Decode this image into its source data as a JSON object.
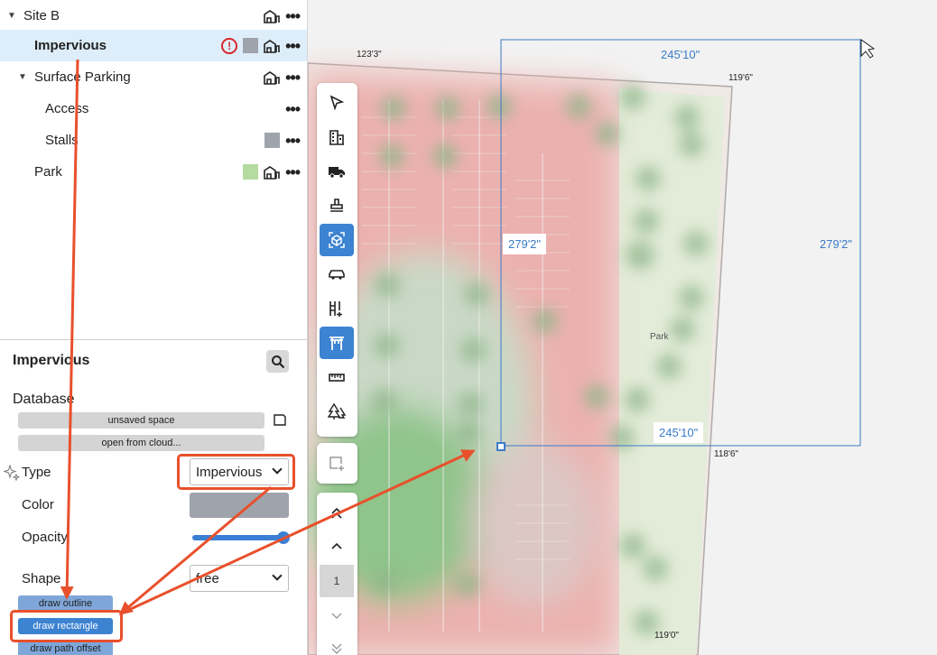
{
  "tree": {
    "site_b": "Site B",
    "impervious": "Impervious",
    "warn_mark": "!",
    "surface_parking": "Surface Parking",
    "access": "Access",
    "stalls": "Stalls",
    "park": "Park",
    "dots": "•••",
    "colors": {
      "gray": "#9fa3ac",
      "green": "#b5dba0"
    }
  },
  "props": {
    "title": "Impervious",
    "database_label": "Database",
    "unsaved_space": "unsaved space",
    "open_from_cloud": "open from cloud...",
    "type_label": "Type",
    "type_value": "Impervious",
    "color_label": "Color",
    "color_value": "#9fa3ac",
    "opacity_label": "Opacity",
    "opacity_value": 1.0,
    "shape_label": "Shape",
    "shape_value": "free",
    "draw_outline": "draw outline",
    "draw_rectangle": "draw rectangle",
    "draw_path_offset": "draw path offset"
  },
  "toolbar": {
    "icons": [
      "cursor-icon",
      "building-icon",
      "truck-icon",
      "stamp-icon",
      "cube-icon",
      "car-icon",
      "grid-add-icon",
      "torii-gate-icon",
      "ruler-icon",
      "trees-icon"
    ],
    "active": [
      "cube-icon",
      "torii-gate-icon"
    ]
  },
  "nav": {
    "page": "1"
  },
  "map": {
    "dim_top": "245'10\"",
    "dim_bottom": "245'10\"",
    "dim_left": "279'2\"",
    "dim_right": "279'2\"",
    "elev_1": "123'3\"",
    "elev_2": "119'6\"",
    "elev_3": "118'6\"",
    "elev_4": "119'0\"",
    "park_label": "Park",
    "accent": "#3a7bc8",
    "annotation_color": "#e8502b"
  }
}
